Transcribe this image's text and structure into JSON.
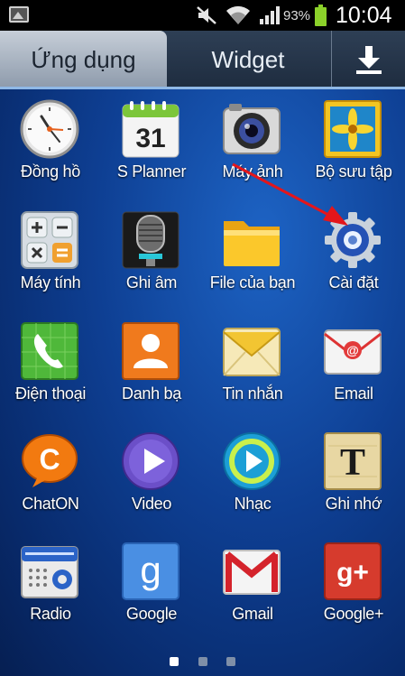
{
  "status_bar": {
    "battery_percent": "93%",
    "time": "10:04",
    "icons": [
      "gallery-notification-icon",
      "mute-icon",
      "wifi-icon",
      "signal-icon",
      "battery-icon"
    ]
  },
  "tabs": {
    "apps_label": "Ứng dụng",
    "widget_label": "Widget",
    "download_icon": "download-icon"
  },
  "apps": [
    {
      "label": "Đồng hồ",
      "icon": "clock-icon"
    },
    {
      "label": "S Planner",
      "icon": "calendar-icon"
    },
    {
      "label": "Máy ảnh",
      "icon": "camera-icon"
    },
    {
      "label": "Bộ sưu tập",
      "icon": "gallery-icon"
    },
    {
      "label": "Máy tính",
      "icon": "calculator-icon"
    },
    {
      "label": "Ghi âm",
      "icon": "microphone-icon"
    },
    {
      "label": "File của bạn",
      "icon": "folder-icon"
    },
    {
      "label": "Cài đặt",
      "icon": "settings-gear-icon"
    },
    {
      "label": "Điện thoại",
      "icon": "phone-icon"
    },
    {
      "label": "Danh bạ",
      "icon": "contacts-icon"
    },
    {
      "label": "Tin nhắn",
      "icon": "messages-icon"
    },
    {
      "label": "Email",
      "icon": "email-icon"
    },
    {
      "label": "ChatON",
      "icon": "chaton-icon"
    },
    {
      "label": "Video",
      "icon": "video-icon"
    },
    {
      "label": "Nhạc",
      "icon": "music-icon"
    },
    {
      "label": "Ghi nhớ",
      "icon": "memo-icon"
    },
    {
      "label": "Radio",
      "icon": "radio-icon"
    },
    {
      "label": "Google",
      "icon": "google-search-icon"
    },
    {
      "label": "Gmail",
      "icon": "gmail-icon"
    },
    {
      "label": "Google+",
      "icon": "google-plus-icon"
    }
  ],
  "calendar_day": "31",
  "chaton_letter": "C",
  "google_letter": "g",
  "googleplus_text": "g+",
  "memo_letter": "T",
  "pager": {
    "pages": 3,
    "current": 1
  },
  "colors": {
    "annotation_arrow": "#e4161b",
    "tab_selected": "#b4bfcc",
    "background": "#0e3f93"
  }
}
